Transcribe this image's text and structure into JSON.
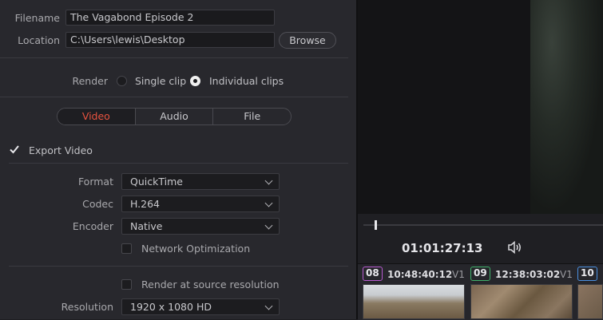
{
  "export": {
    "filename_label": "Filename",
    "filename_value": "The Vagabond Episode 2",
    "location_label": "Location",
    "location_value": "C:\\Users\\lewis\\Desktop",
    "browse_label": "Browse",
    "render_label": "Render",
    "render_options": [
      "Single clip",
      "Individual clips"
    ],
    "render_selected": "Individual clips",
    "tabs": [
      "Video",
      "Audio",
      "File"
    ],
    "active_tab": "Video",
    "export_video_label": "Export Video",
    "export_video_checked": true,
    "format_label": "Format",
    "format_value": "QuickTime",
    "codec_label": "Codec",
    "codec_value": "H.264",
    "encoder_label": "Encoder",
    "encoder_value": "Native",
    "network_opt_label": "Network Optimization",
    "network_opt_checked": false,
    "render_source_label": "Render at source resolution",
    "render_source_checked": false,
    "resolution_label": "Resolution",
    "resolution_value": "1920 x 1080 HD"
  },
  "viewer": {
    "timecode": "01:01:27:13",
    "icons": [
      "speaker-icon"
    ]
  },
  "clips": [
    {
      "index": "08",
      "timecode": "10:48:40:12",
      "track": "V1"
    },
    {
      "index": "09",
      "timecode": "12:38:03:02",
      "track": "V1"
    },
    {
      "index": "10"
    }
  ],
  "colors": {
    "accent": "#e8533f",
    "panel_bg": "#28282d",
    "viewer_bg": "#141416"
  }
}
